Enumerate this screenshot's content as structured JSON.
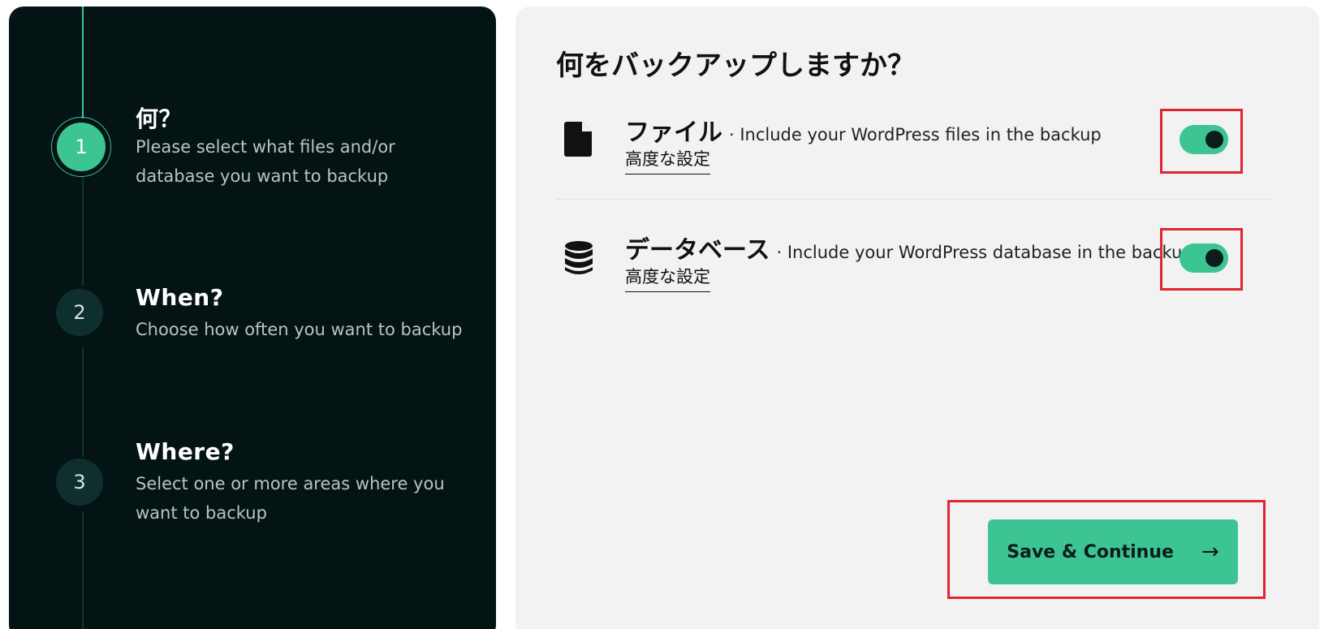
{
  "stepper": {
    "steps": [
      {
        "number": "1",
        "title": "何？",
        "description": "Please select what files and/or database you want to backup",
        "state": "active"
      },
      {
        "number": "2",
        "title": "When?",
        "description": "Choose how often you want to backup",
        "state": "inactive"
      },
      {
        "number": "3",
        "title": "Where?",
        "description": "Select one or more areas where you want to backup",
        "state": "inactive"
      }
    ]
  },
  "main": {
    "title": "何をバックアップしますか？",
    "options": [
      {
        "icon": "file-icon",
        "name": "ファイル",
        "description": "· Include your WordPress files in the backup",
        "link": "高度な設定",
        "enabled": true
      },
      {
        "icon": "database-icon",
        "name": "データベース",
        "description": "· Include your WordPress database in the backup",
        "link": "高度な設定",
        "enabled": true
      }
    ],
    "save_label": "Save & Continue",
    "save_icon": "arrow-right-icon"
  },
  "colors": {
    "accent": "#3cc592",
    "sidebar_bg": "#041414",
    "content_bg": "#f2f2f2",
    "highlight": "#e02530"
  }
}
